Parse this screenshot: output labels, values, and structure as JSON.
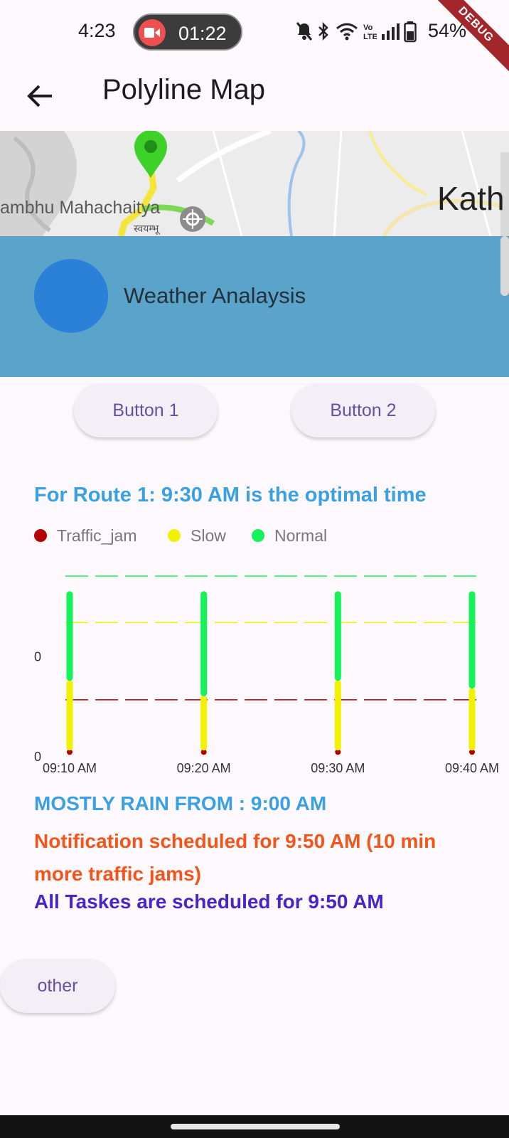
{
  "status_bar": {
    "time": "4:23",
    "recording_time": "01:22",
    "battery_percent": "54%",
    "debug_label": "DEBUG"
  },
  "app_bar": {
    "title": "Polyline Map",
    "back_icon": "arrow-back-icon"
  },
  "map": {
    "place_label": "ambhu Mahachaitya",
    "place_label_small": "स्वयम्भू",
    "city_label": "Kath",
    "marker_color": "#3ed12a"
  },
  "banner": {
    "title": "Weather Analaysis",
    "background_color": "#5aa3cb",
    "avatar_color": "#2a81d7"
  },
  "buttons": {
    "button1": "Button 1",
    "button2": "Button 2",
    "other": "other"
  },
  "route_title": "For Route 1: 9:30 AM is the optimal time",
  "chart_data": {
    "type": "bar",
    "legend": [
      {
        "name": "Traffic_jam",
        "color": "#b30000"
      },
      {
        "name": "Slow",
        "color": "#f2f200"
      },
      {
        "name": "Normal",
        "color": "#15f25a"
      }
    ],
    "categories": [
      "09:10 AM",
      "09:20 AM",
      "09:30 AM",
      "09:40 AM"
    ],
    "y_tick_labels": [
      "0",
      "0"
    ],
    "series": [
      {
        "name": "Traffic_jam",
        "values": [
          0.05,
          0.05,
          0.05,
          0.05
        ]
      },
      {
        "name": "Slow",
        "values": [
          0.9,
          0.7,
          0.9,
          0.8
        ]
      },
      {
        "name": "Normal",
        "values": [
          1.15,
          1.35,
          1.15,
          1.25
        ]
      }
    ],
    "reference_lines": [
      {
        "series": "Normal",
        "value": 2.3
      },
      {
        "series": "Slow",
        "value": 1.7
      },
      {
        "series": "Traffic_jam",
        "value": 0.7
      }
    ],
    "ylim": [
      0,
      2.3
    ],
    "grid": false,
    "legend_position": "top-left"
  },
  "messages": {
    "rain": "MOSTLY RAIN FROM : 9:00 AM",
    "notification": "Notification scheduled for 9:50 AM (10 min more traffic jams)",
    "tasks": "All Taskes are scheduled for 9:50 AM"
  }
}
